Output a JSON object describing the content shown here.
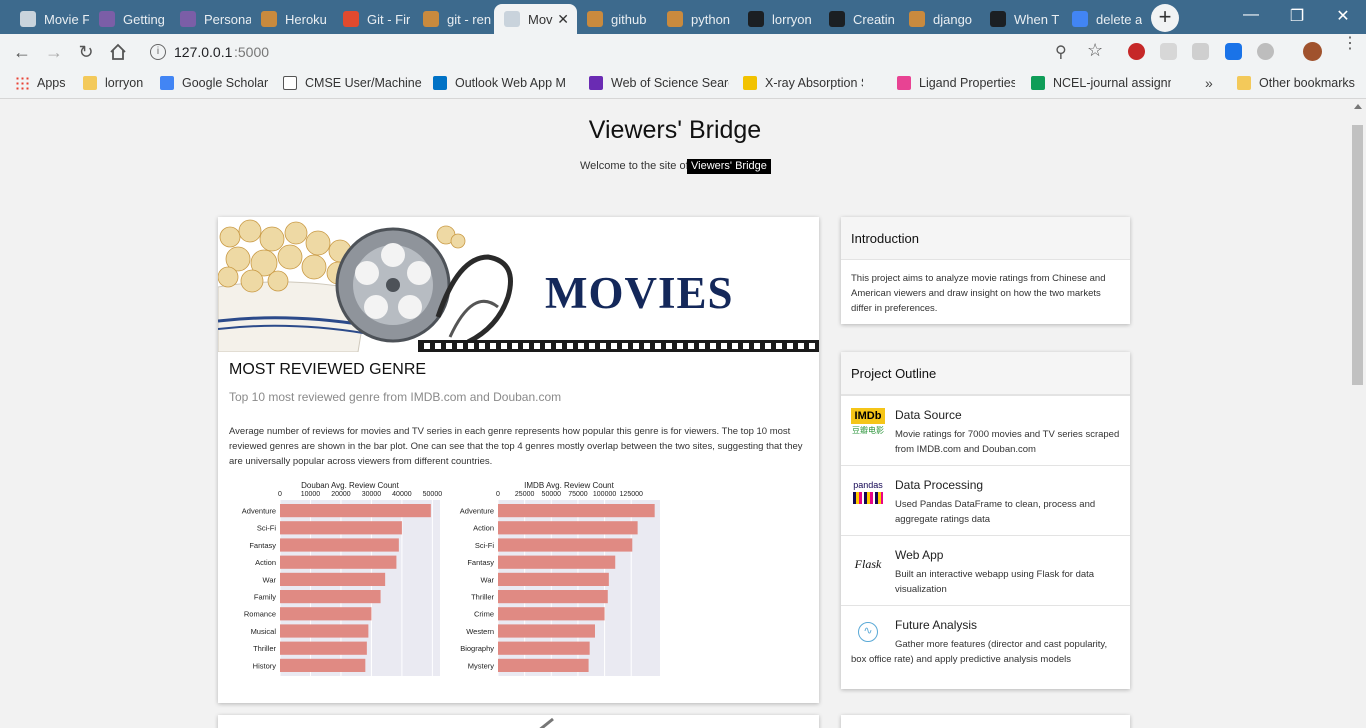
{
  "browser": {
    "tabs": [
      {
        "label": "Movie F",
        "icon": "page-icon",
        "color": "#c9d3dc"
      },
      {
        "label": "Getting",
        "icon": "heroku-icon",
        "color": "#7b5ea7"
      },
      {
        "label": "Persona",
        "icon": "heroku-icon",
        "color": "#7b5ea7"
      },
      {
        "label": "Heroku",
        "icon": "stackoverflow-icon",
        "color": "#c98a3e"
      },
      {
        "label": "Git - Fir",
        "icon": "git-icon",
        "color": "#e24a2e"
      },
      {
        "label": "git - ren",
        "icon": "stackoverflow-icon",
        "color": "#c98a3e"
      },
      {
        "label": "Mov",
        "icon": "page-icon",
        "color": "#c9d3dc"
      },
      {
        "label": "github",
        "icon": "stackoverflow-icon",
        "color": "#c98a3e"
      },
      {
        "label": "python",
        "icon": "stackoverflow-icon",
        "color": "#c98a3e"
      },
      {
        "label": "lorryon",
        "icon": "github-icon",
        "color": "#1b1f23"
      },
      {
        "label": "Creatin",
        "icon": "github-icon",
        "color": "#1b1f23"
      },
      {
        "label": "django",
        "icon": "stackoverflow-icon",
        "color": "#c98a3e"
      },
      {
        "label": "When T",
        "icon": "github-icon",
        "color": "#1b1f23"
      },
      {
        "label": "delete a",
        "icon": "google-icon",
        "color": "#4285f4"
      }
    ],
    "active_tab_close": "✕",
    "new_tab": "+",
    "url_host": "127.0.0.1",
    "url_port": ":5000",
    "bookmarks": [
      {
        "label": "Apps",
        "icon": "apps-icon"
      },
      {
        "label": "lorryon",
        "icon": "folder-icon"
      },
      {
        "label": "Google Scholar",
        "icon": "scholar-icon"
      },
      {
        "label": "CMSE User/Machine I",
        "icon": "page-icon"
      },
      {
        "label": "Outlook Web App M",
        "icon": "outlook-icon"
      },
      {
        "label": "Web of Science Searc",
        "icon": "wos-icon"
      },
      {
        "label": "X-ray Absorption Spe",
        "icon": "xray-icon"
      },
      {
        "label": "Ligand Properties",
        "icon": "ligand-icon"
      },
      {
        "label": "NCEL-journal assignm",
        "icon": "sheets-icon"
      }
    ],
    "bookmarks_overflow": "»",
    "other_bookmarks": "Other bookmarks"
  },
  "page": {
    "title": "Viewers' Bridge",
    "welcome_text": "Welcome to the site of",
    "welcome_badge": "Viewers' Bridge",
    "banner_text": "MOVIES",
    "card_heading": "MOST REVIEWED GENRE",
    "card_subheading": "Top 10 most reviewed genre from IMDB.com and Douban.com",
    "card_body": "Average number of reviews for movies and TV series in each genre represents how popular this genre is for viewers. The top 10 most reviewed genres are shown in the bar plot. One can see that the top 4 genres mostly overlap between the two sites, suggesting that they are universally popular across viewers from different countries.",
    "intro": {
      "heading": "Introduction",
      "text": "This project aims to analyze movie ratings from Chinese and American viewers and draw insight on how the two markets differ in preferences."
    },
    "outline": {
      "heading": "Project Outline",
      "items": [
        {
          "title": "Data Source",
          "desc": "Movie ratings for 7000 movies and TV series scraped from IMDB.com and Douban.com",
          "logo_top": "IMDb",
          "logo_bottom": "豆瓣电影"
        },
        {
          "title": "Data Processing",
          "desc": "Used Pandas DataFrame to clean, process and aggregate ratings data",
          "logo_top": "pandas"
        },
        {
          "title": "Web App",
          "desc": "Built an interactive webapp using Flask for data visualization",
          "logo_top": "Flask"
        },
        {
          "title": "Future Analysis",
          "desc": "Gather more features (director and cast popularity, box office rate) and apply predictive analysis models",
          "logo_top": "∿"
        }
      ]
    }
  },
  "colors": {
    "bar": "#e08a83",
    "plot_bg": "#eaeaf2",
    "grid": "#ffffff"
  },
  "chart_data": [
    {
      "type": "bar",
      "orientation": "horizontal",
      "title": "Douban Avg. Review Count",
      "xticks": [
        0,
        10000,
        20000,
        30000,
        40000,
        50000
      ],
      "xlim": [
        0,
        52500
      ],
      "categories": [
        "Adventure",
        "Sci-Fi",
        "Fantasy",
        "Action",
        "War",
        "Family",
        "Romance",
        "Musical",
        "Thriller",
        "History"
      ],
      "values": [
        49500,
        40000,
        39000,
        38200,
        34500,
        33000,
        30000,
        29000,
        28500,
        28000
      ]
    },
    {
      "type": "bar",
      "orientation": "horizontal",
      "title": "IMDB Avg. Review Count",
      "xticks": [
        0,
        25000,
        50000,
        75000,
        100000,
        125000
      ],
      "xlim": [
        0,
        152000
      ],
      "categories": [
        "Adventure",
        "Action",
        "Sci-Fi",
        "Fantasy",
        "War",
        "Thriller",
        "Crime",
        "Western",
        "Biography",
        "Mystery"
      ],
      "values": [
        147000,
        131000,
        126000,
        110000,
        104000,
        103000,
        100000,
        91000,
        86000,
        85000
      ]
    }
  ]
}
